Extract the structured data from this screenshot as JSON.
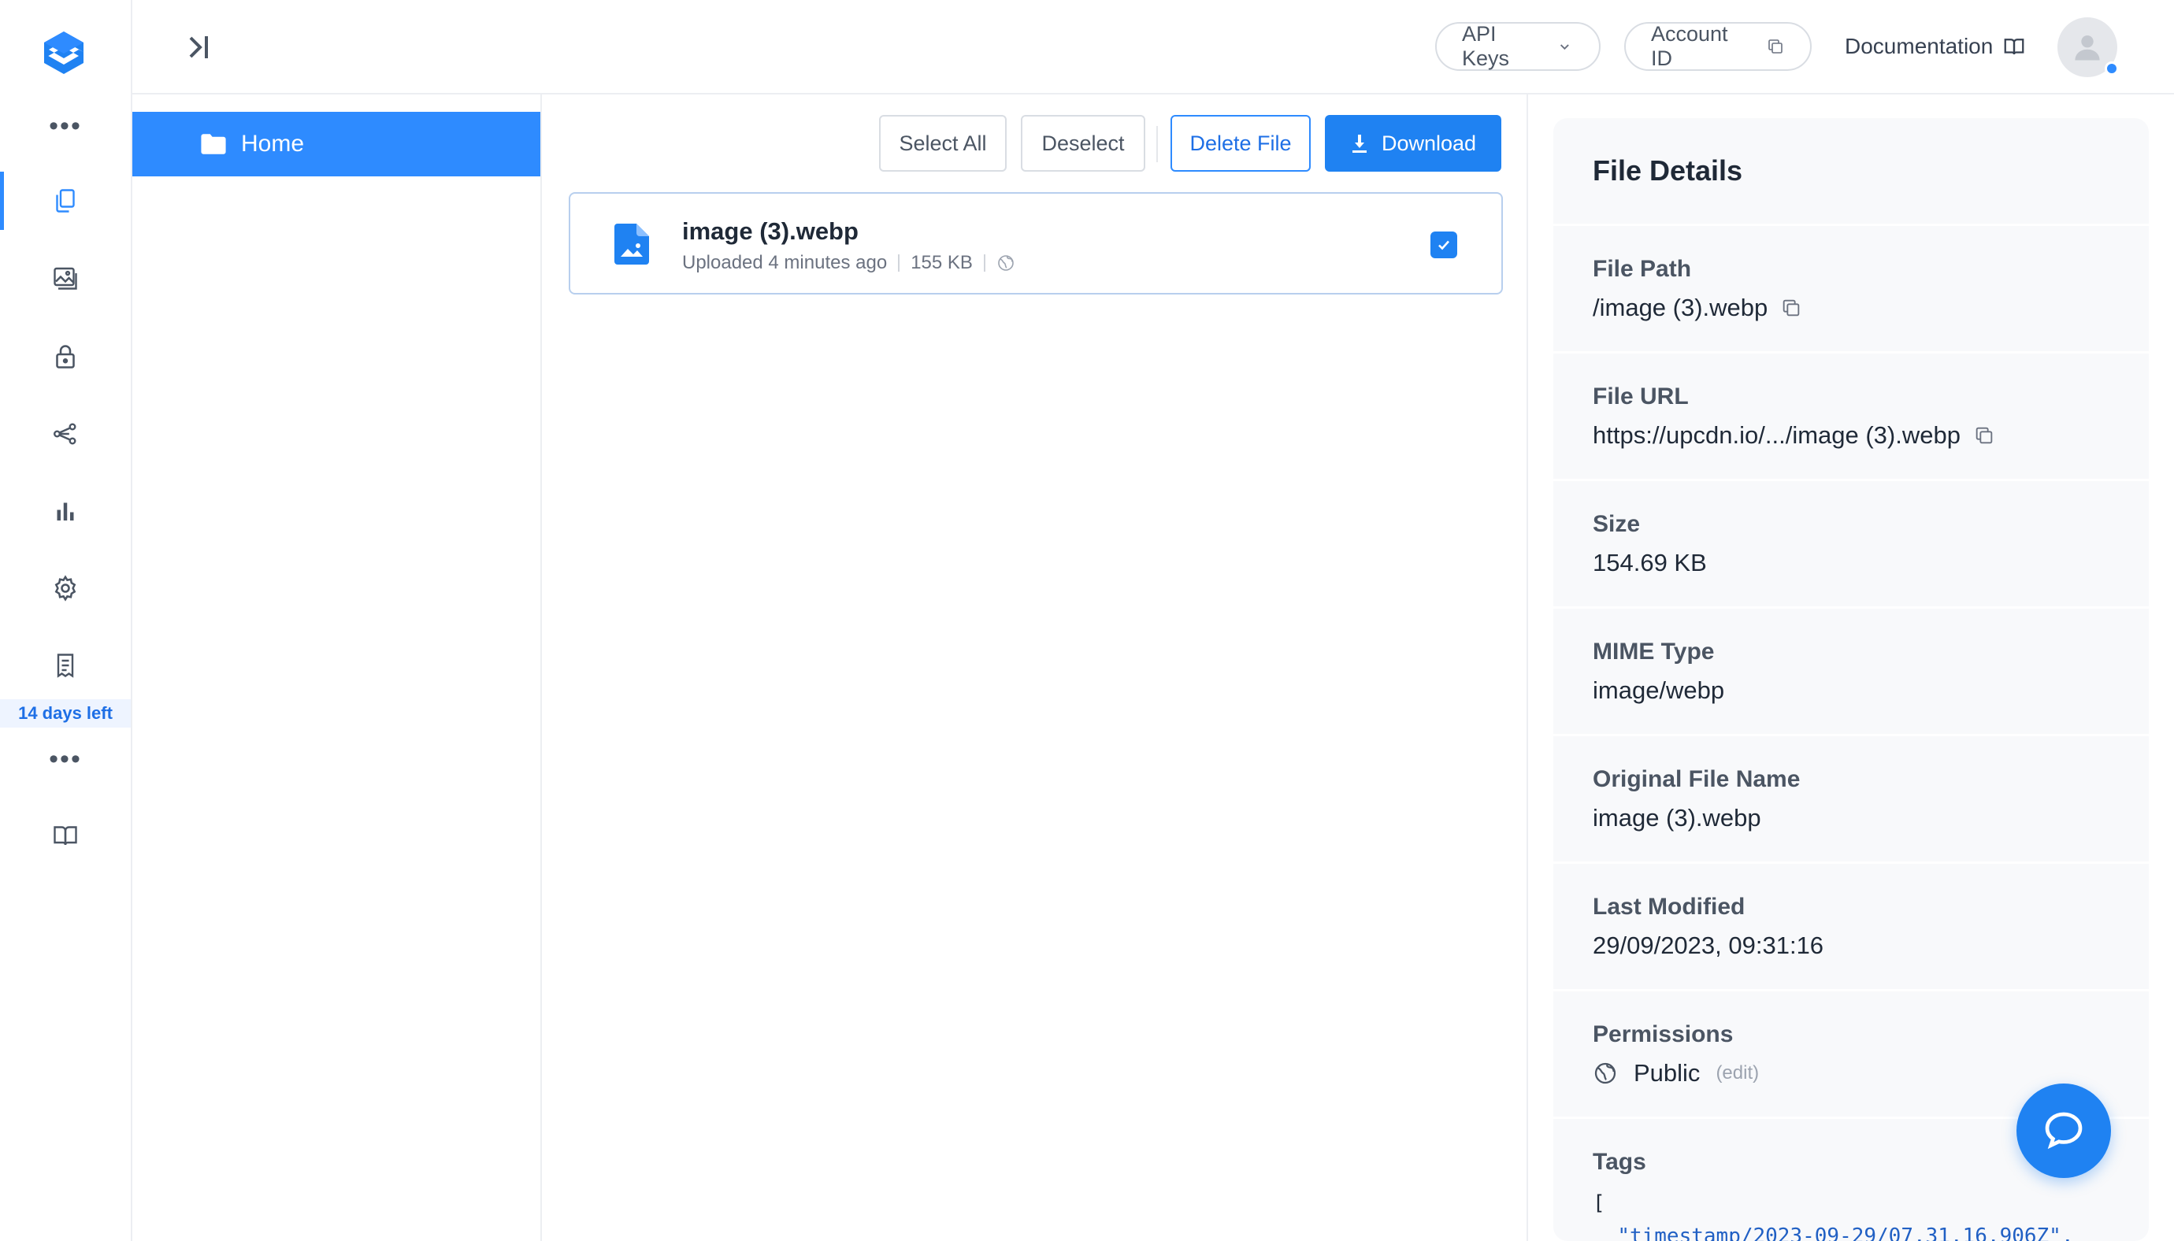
{
  "colors": {
    "accent": "#2e8bff",
    "primary_button": "#1f82f2",
    "trial_bg": "#eef4ff"
  },
  "rail": {
    "logo_icon": "upload-cube-logo",
    "items": [
      {
        "name": "more",
        "icon": "ellipsis-icon"
      },
      {
        "name": "files",
        "icon": "files-icon",
        "active": true
      },
      {
        "name": "images",
        "icon": "image-icon"
      },
      {
        "name": "security",
        "icon": "lock-icon"
      },
      {
        "name": "integrations",
        "icon": "share-nodes-icon"
      },
      {
        "name": "analytics",
        "icon": "bar-chart-icon"
      },
      {
        "name": "settings",
        "icon": "gear-icon"
      },
      {
        "name": "billing",
        "icon": "receipt-icon"
      },
      {
        "name": "more-2",
        "icon": "ellipsis-icon"
      },
      {
        "name": "docs",
        "icon": "book-icon"
      }
    ],
    "trial_text": "14 days left"
  },
  "topbar": {
    "api_keys_label": "API Keys",
    "account_id_label": "Account ID",
    "documentation_label": "Documentation"
  },
  "folders": {
    "items": [
      {
        "label": "Home",
        "active": true
      }
    ]
  },
  "toolbar": {
    "select_all": "Select All",
    "deselect": "Deselect",
    "delete_file": "Delete File",
    "download": "Download"
  },
  "files": [
    {
      "name": "image (3).webp",
      "uploaded": "Uploaded 4 minutes ago",
      "size": "155 KB",
      "selected": true
    }
  ],
  "details": {
    "title": "File Details",
    "file_path": {
      "label": "File Path",
      "value": "/image (3).webp"
    },
    "file_url": {
      "label": "File URL",
      "value": "https://upcdn.io/.../image (3).webp"
    },
    "size": {
      "label": "Size",
      "value": "154.69 KB"
    },
    "mime": {
      "label": "MIME Type",
      "value": "image/webp"
    },
    "original_name": {
      "label": "Original File Name",
      "value": "image (3).webp"
    },
    "last_modified": {
      "label": "Last Modified",
      "value": "29/09/2023, 09:31:16"
    },
    "permissions": {
      "label": "Permissions",
      "value": "Public",
      "edit": "(edit)"
    },
    "tags": {
      "label": "Tags",
      "open": "[",
      "first": "\"timestamp/2023-09-29/07.31.16.906Z\","
    }
  }
}
